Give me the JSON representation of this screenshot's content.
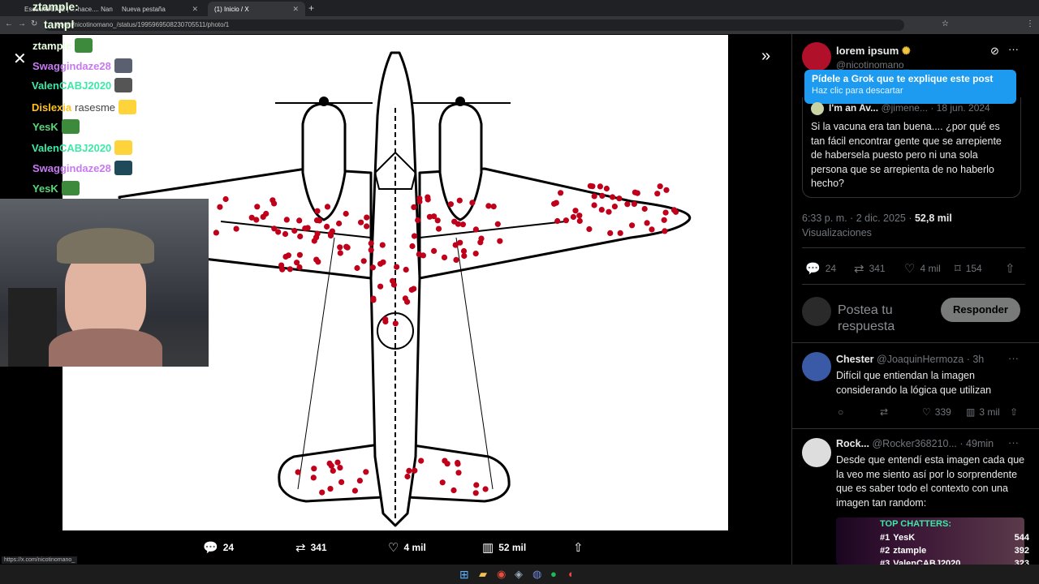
{
  "browser": {
    "tabs": [
      {
        "label": "Escucha LIVE | ... hace.... Nan",
        "active": false
      },
      {
        "label": "Nueva pestaña",
        "active": false
      },
      {
        "label": "(1) Inicio / X",
        "active": true
      }
    ],
    "url": "x.com/nicotinomano_/status/1995969508230705511/photo/1",
    "status_url": "https://x.com/nicotinomano_"
  },
  "viewer": {
    "actions": {
      "replies": "24",
      "reposts": "341",
      "likes": "4 mil",
      "views": "52 mil"
    }
  },
  "chat": {
    "lines": [
      {
        "user": "ztample",
        "color": "#e8ffe0"
      },
      {
        "user": "Swaggindaze28",
        "color": "#c779f2"
      },
      {
        "user": "ValenCABJ2020",
        "color": "#3ee8a8"
      },
      {
        "user": "Dislexia",
        "color": "#ffc21a",
        "extra": "rasesme"
      },
      {
        "user": "YesK",
        "color": "#5ad67a"
      },
      {
        "user": "ValenCABJ2020",
        "color": "#3ee8a8"
      },
      {
        "user": "Swaggindaze28",
        "color": "#c779f2"
      },
      {
        "user": "YesK",
        "color": "#5ad67a"
      }
    ],
    "top_user": "ztample:",
    "top_user2": "tampl"
  },
  "panel": {
    "author_name": "lorem ipsum",
    "author_handle": "@nicotinomano_",
    "grok_title": "Pídele a Grok que te explique este post",
    "grok_subtitle": "Haz clic para descartar",
    "quote": {
      "name": "I'm an Av...",
      "handle": "@jimene...",
      "date": "18 jun. 2024",
      "text": "Si la vacuna era tan buena.... ¿por qué es tan fácil encontrar gente que se arrepiente de habersela puesto pero ni una sola persona que se arrepienta de no haberlo hecho?"
    },
    "timestamp": "6:33 p. m. · 2 dic. 2025 ·",
    "views_count": "52,8 mil",
    "views_label": "Visualizaciones",
    "stats": {
      "replies": "24",
      "reposts": "341",
      "likes": "4 mil",
      "bookmarks": "154"
    },
    "reply_placeholder": "Postea tu respuesta",
    "reply_button": "Responder",
    "replies": [
      {
        "name": "Chester",
        "handle": "@JoaquinHermoza",
        "time": "3h",
        "text": "Difícil que entiendan la imagen considerando la lógica que utilizan",
        "likes": "339",
        "views": "3 mil"
      },
      {
        "name": "Rock...",
        "handle": "@Rocker368210...",
        "time": "49min",
        "text": "Desde que entendí esta imagen cada que la veo me siento así por lo sorprendente que es saber todo el contexto con una imagen tan random:"
      }
    ]
  },
  "top_chatters": {
    "title": "TOP CHATTERS:",
    "rows": [
      {
        "rank": "#1",
        "name": "YesK",
        "count": "544"
      },
      {
        "rank": "#2",
        "name": "ztample",
        "count": "392"
      },
      {
        "rank": "#3",
        "name": "ValenCABJ2020",
        "count": "323"
      }
    ]
  },
  "colors": {
    "accent": "#1d9bf0",
    "bullet": "#c0001a",
    "chatter_green": "#3ee8a8"
  }
}
